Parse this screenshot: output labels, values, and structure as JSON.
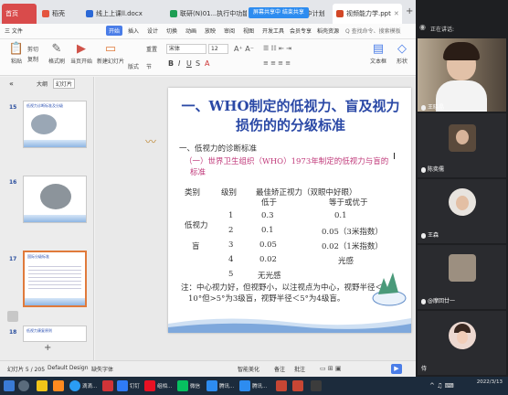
{
  "tabs": [
    {
      "label": "首页",
      "icon": "home-icon"
    },
    {
      "label": "稻壳",
      "icon": "docer-icon"
    },
    {
      "label": "线上上课ll.docx",
      "icon": "word-icon"
    },
    {
      "label": "联研(N)01...执行中功能导",
      "icon": "excel-icon"
    },
    {
      "label": "...执行中计划",
      "icon": "excel-icon"
    },
    {
      "label": "视频能力学.ppt",
      "icon": "ppt-icon"
    }
  ],
  "meeting_banner": "屏幕共享中  结束共享",
  "menubar": {
    "file": "三 文件",
    "items": [
      "开始",
      "插入",
      "设计",
      "切换",
      "动画",
      "放映",
      "审阅",
      "视图",
      "开发工具",
      "会员专享",
      "稻壳资源"
    ],
    "active": "开始",
    "search": "Q 查找命令、搜索模板"
  },
  "ribbon": {
    "paste": "粘贴",
    "cut": "剪切",
    "copy": "复制",
    "format_painter": "格式刷",
    "from_current": "当页开始",
    "new_slide": "新建幻灯片",
    "layout": "版式",
    "section": "节",
    "reset": "重置",
    "font_name": "宋体",
    "font_size": "12",
    "text_box": "文本框",
    "shape": "形状"
  },
  "left_panel": {
    "tab_outline": "大纲",
    "tab_slides": "幻灯片",
    "slides": [
      {
        "num": "15",
        "title": "低视力诊断标准及分级"
      },
      {
        "num": "16",
        "title": ""
      },
      {
        "num": "17",
        "title": "国际分级标准"
      },
      {
        "num": "18",
        "title": "低视力康复原则"
      }
    ]
  },
  "slide": {
    "title_line1": "一、WHO制定的低视力、盲及视力",
    "title_line2": "损伤的的分级标准",
    "section": "一、低视力的诊断标准",
    "sub_line1": "（一）世界卫生组织（WHO）1973年制定的低视力与盲的",
    "sub_line2": "标准",
    "header_cat": "类别",
    "header_level": "级别",
    "header_best": "最佳矫正视力（双眼中好眼）",
    "header_lower": "低于",
    "header_ge": "等于或优于",
    "rows": [
      {
        "cat": "",
        "level": "1",
        "lower": "0.3",
        "ge": "0.1"
      },
      {
        "cat": "低视力",
        "level": "",
        "lower": "",
        "ge": ""
      },
      {
        "cat": "",
        "level": "2",
        "lower": "0.1",
        "ge": "0.05（3米指数）"
      },
      {
        "cat": "盲",
        "level": "3",
        "lower": "0.05",
        "ge": "0.02（1米指数）"
      },
      {
        "cat": "",
        "level": "4",
        "lower": "0.02",
        "ge": "光感"
      },
      {
        "cat": "",
        "level": "5",
        "lower": "无光感",
        "ge": ""
      }
    ],
    "note_line1": "注：中心视力好，但视野小，以注视点为中心，视野半径＜",
    "note_line2": "10°但>5°为3级盲，视野半径＜5°为4级盲。"
  },
  "statusbar": {
    "slide_pos": "幻灯片 5 / 205",
    "theme": "Default Design",
    "missing_font": "缺失字体",
    "smart_beautify": "智能美化",
    "notes": "备注",
    "comments": "批注"
  },
  "meeting": {
    "speaking": "正在讲话:",
    "participants": [
      {
        "name": "王晓晶"
      },
      {
        "name": "陈奕儒"
      },
      {
        "name": "王森"
      },
      {
        "name": "@摩回廿一"
      },
      {
        "name": "侍"
      }
    ]
  },
  "taskbar": {
    "items": [
      "滴滴...",
      "钉钉",
      "组相...",
      "微信",
      "腾讯...",
      "腾讯..."
    ],
    "time": "",
    "date": "2022/3/13"
  }
}
